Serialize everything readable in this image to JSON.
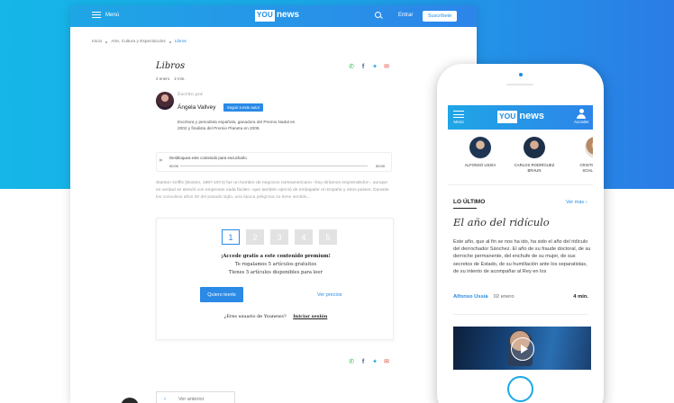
{
  "colors": {
    "brand_blue": "#2a8ae6",
    "bg_start": "#16b6e8",
    "bg_end": "#2b7ce6"
  },
  "desktop": {
    "header": {
      "menu_label": "Menú",
      "logo_you": "YOU",
      "logo_news": "news",
      "search_icon": "search-icon",
      "entrar": "Entrar",
      "suscribete": "Suscríbete"
    },
    "breadcrumb": [
      "Inicio",
      "Arte, Cultura y Espectáculos",
      "Libros"
    ],
    "article": {
      "section_title": "Libros",
      "date": "2 enero",
      "read_time": "2 min.",
      "escrito_por": "Escrito por",
      "author": "Ángela Vallvey",
      "follow_button": "Seguir a este autor",
      "bio": "Escritora y periodista española, ganadora del Premio Nadal en 2002 y finalista del Premio Planeta en 2008.",
      "audio_label": "Desbloquea este contenido para escucharlo",
      "audio_start": "00:00",
      "audio_end": "00:00",
      "body": "Stanton Griffis (Boston, 1887-1974) fue un hombre de negocios norteamericano –hoy diríamos emprendedor–, aunque en verdad se atrevió con empresas nada fáciles –que también ejerció de embajador en España y otros países. Durante los convulsos años 30 del pasado siglo, una época peligrosa no tiene sentido..."
    },
    "paywall": {
      "steps": [
        "1",
        "2",
        "3",
        "4",
        "5"
      ],
      "heading": "¡Accede gratis a este contenido premium!",
      "line1": "Te regalamos 5 artículos gratuitos",
      "line2": "Tienes 5 artículos disponibles para leer",
      "cta": "Quiero leerlo",
      "prices": "Ver precios",
      "user_q": "¿Eres usuario de Younews?",
      "login": "Iniciar sesión"
    },
    "prev_label": "Ver anterior"
  },
  "mobile": {
    "header": {
      "menu_label": "Menú",
      "logo_you": "YOU",
      "logo_news": "news",
      "account_label": "Acceder"
    },
    "authors": [
      {
        "name": "ALFONSO USSÍA"
      },
      {
        "name": "CARLOS RODRÍGUEZ BRAUN"
      },
      {
        "name": "CRISTINA LÓPEZ SCHLICHTING"
      }
    ],
    "latest_label": "LO ÚLTIMO",
    "see_more": "Ver más",
    "article": {
      "title": "El año del ridículo",
      "excerpt": "Este año, que al fin se nos ha ido, ha sido el año del ridículo del derrochador Sánchez. El año de su fraude doctoral, de su derroche permanente, del enchufe de su mujer, de sus secretos de Estado, de su humillación ante los separatistas, de su intento de acompañar al Rey en los",
      "author": "Alfonso Ussía",
      "date": "02 enero",
      "read_time": "4 min."
    }
  }
}
